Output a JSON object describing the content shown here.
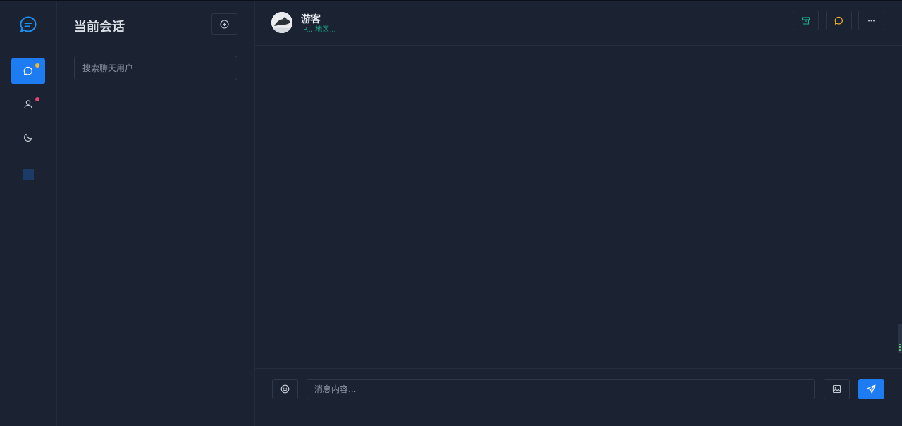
{
  "rail": {
    "items": [
      {
        "name": "chat",
        "active": true,
        "badge_color": "#f5b82e"
      },
      {
        "name": "user",
        "active": false,
        "badge_color": "#e2477b"
      },
      {
        "name": "theme-moon",
        "active": false
      }
    ]
  },
  "list": {
    "title": "当前会话",
    "search_placeholder": "搜索聊天用户"
  },
  "chat": {
    "name": "游客",
    "subtitle": "IP... 地区...",
    "input_placeholder": "消息内容..."
  },
  "colors": {
    "accent": "#1d7cf2",
    "success": "#1bb38d",
    "warning": "#f5b82e",
    "danger": "#e2477b"
  }
}
